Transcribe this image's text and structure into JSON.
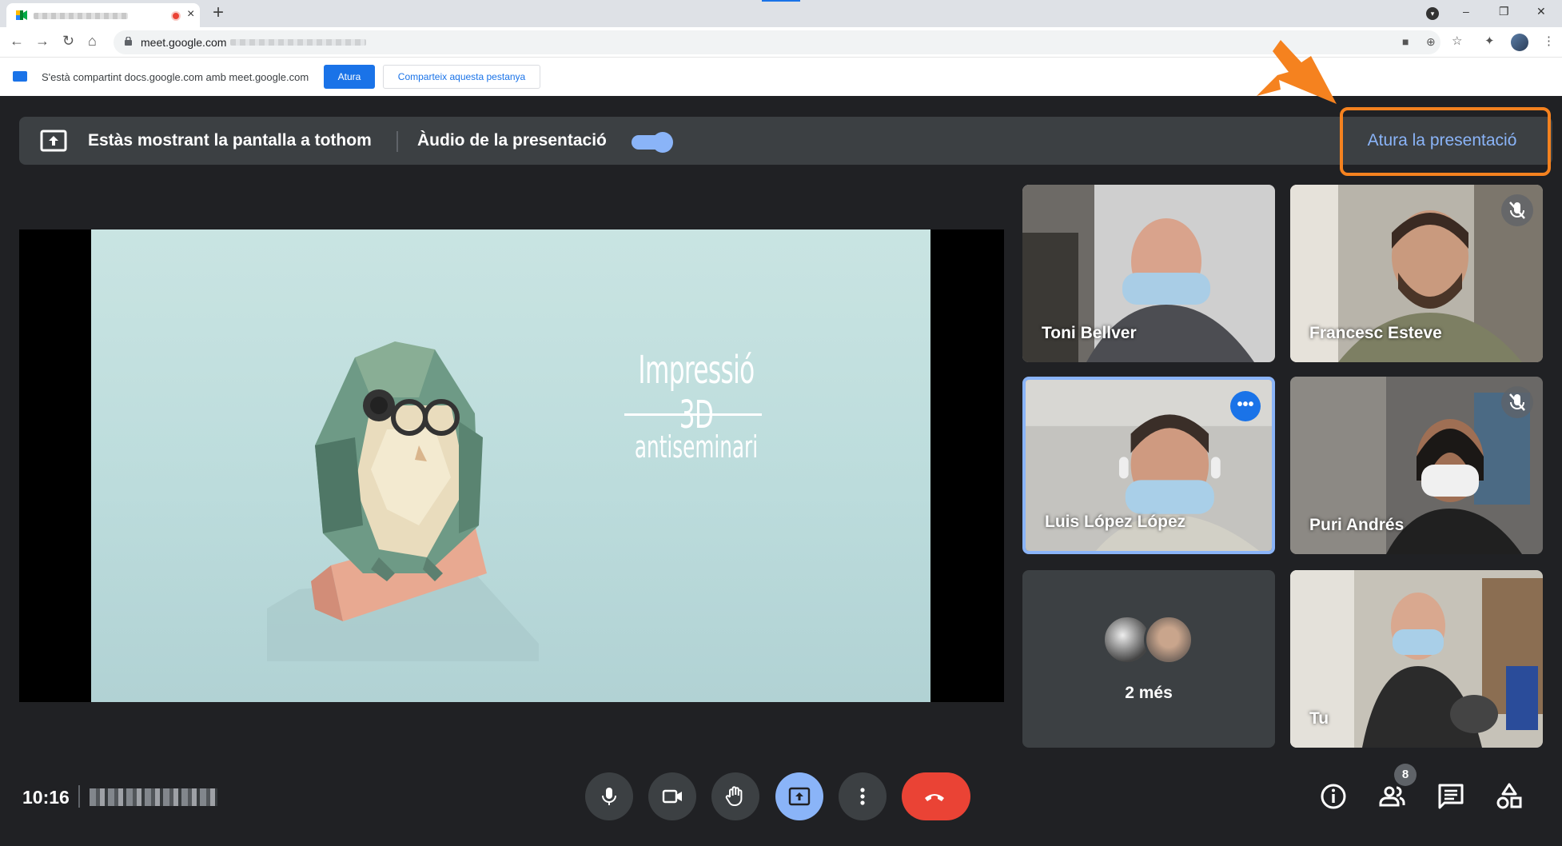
{
  "browser": {
    "new_tab_symbol": "+",
    "tab_close_symbol": "×",
    "url": "meet.google.com",
    "window_controls": {
      "minimize": "–",
      "restore": "❐",
      "close": "✕"
    },
    "nav": {
      "back": "←",
      "forward": "→",
      "reload": "↻",
      "home": "⌂"
    }
  },
  "share_bar": {
    "message": "S'està compartint docs.google.com amb meet.google.com",
    "stop_label": "Atura",
    "share_tab_label": "Comparteix aquesta pestanya"
  },
  "banner": {
    "message": "Estàs mostrant la pantalla a tothom",
    "audio_label": "Àudio de la presentació",
    "audio_enabled": true,
    "stop_presenting_label": "Atura la presentació"
  },
  "slide": {
    "title": "Impressió 3D",
    "subtitle": "antiseminari"
  },
  "participants": [
    {
      "name": "Toni Bellver",
      "muted": false
    },
    {
      "name": "Francesc Esteve",
      "muted": true
    },
    {
      "name": "Luis López López",
      "muted": false,
      "active_speaker": true
    },
    {
      "name": "Puri Andrés",
      "muted": true
    },
    {
      "name": "Tu",
      "muted": false
    }
  ],
  "more_participants": {
    "label": "2 més"
  },
  "bottom_bar": {
    "time": "10:16",
    "people_count": "8"
  },
  "colors": {
    "meet_background": "#202124",
    "tile_background": "#3c4043",
    "accent_blue": "#8ab4f8",
    "leave_red": "#ea4335",
    "highlight_orange": "#f5821f"
  }
}
